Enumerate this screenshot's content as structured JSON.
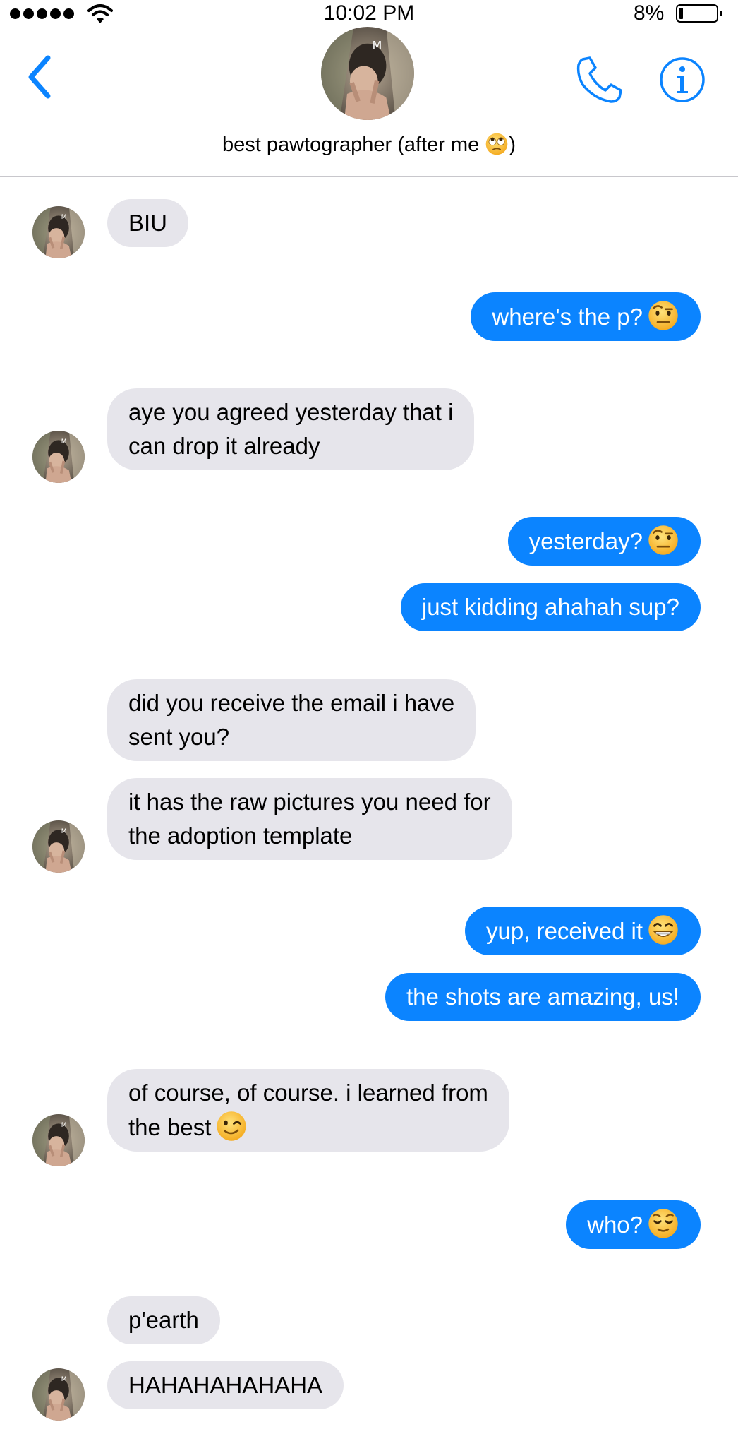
{
  "status_bar": {
    "time": "10:02 PM",
    "battery_percent": "8%"
  },
  "header": {
    "title": "best pawtographer (after me",
    "title_end": ")"
  },
  "messages": [
    {
      "from": "them",
      "text": "BIU"
    },
    {
      "from": "me",
      "text": "where's the p?",
      "emoji": "raised-eyebrow"
    },
    {
      "from": "them",
      "lines": [
        "aye you agreed yesterday that i",
        "can drop it already"
      ]
    },
    {
      "from": "me",
      "text": "yesterday?",
      "emoji": "raised-eyebrow"
    },
    {
      "from": "me",
      "text": "just kidding ahahah sup?"
    },
    {
      "from": "them",
      "lines": [
        "did you receive the email i have",
        "sent you?"
      ]
    },
    {
      "from": "them",
      "lines": [
        "it has the raw pictures you need for",
        "the adoption template"
      ]
    },
    {
      "from": "me",
      "text": "yup, received it",
      "emoji": "grinning"
    },
    {
      "from": "me",
      "text": "the shots are amazing, us!"
    },
    {
      "from": "them",
      "lines": [
        "of course, of course. i learned from",
        "the best"
      ],
      "emoji": "winking"
    },
    {
      "from": "me",
      "text": "who?",
      "emoji": "relieved"
    },
    {
      "from": "them",
      "text": "p'earth"
    },
    {
      "from": "them",
      "text": "HAHAHAHAHAHA"
    }
  ]
}
